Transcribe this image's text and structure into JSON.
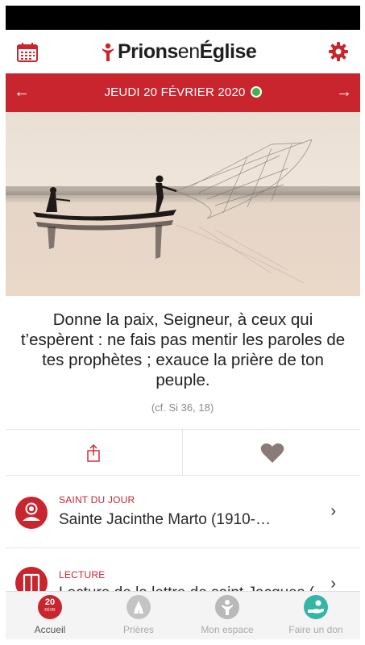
{
  "header": {
    "logo_text": "PrionsenÉglise",
    "logo_part1": "Prions",
    "logo_part2": "en",
    "logo_part3": "Église"
  },
  "datebar": {
    "date": "JEUDI 20 FÉVRIER 2020",
    "prev_icon": "arrow-left",
    "next_icon": "arrow-right",
    "status_color": "#3fb34f"
  },
  "quote": {
    "text": "Donne la paix, Seigneur, à ceux qui t’espèrent : ne fais pas mentir les paroles de tes prophètes ; exauce la prière de ton peuple.",
    "reference": "(cf. Si 36, 18)"
  },
  "items": [
    {
      "category": "SAINT DU JOUR",
      "title": "Sainte Jacinthe Marto (1910-…",
      "icon": "saint-icon"
    },
    {
      "category": "LECTURE",
      "title": "Lecture de la lettre de saint Jacques (…",
      "icon": "book-icon"
    }
  ],
  "tabbar": {
    "tabs": [
      {
        "label": "Accueil",
        "badge_day": "20",
        "badge_month": "FÉVR",
        "active": true
      },
      {
        "label": "Prières",
        "active": false
      },
      {
        "label": "Mon espace",
        "active": false
      },
      {
        "label": "Faire un don",
        "active": false
      }
    ]
  },
  "colors": {
    "brand_red": "#c9252e",
    "teal": "#35b5a5",
    "inactive_gray": "#b9b9b9"
  }
}
